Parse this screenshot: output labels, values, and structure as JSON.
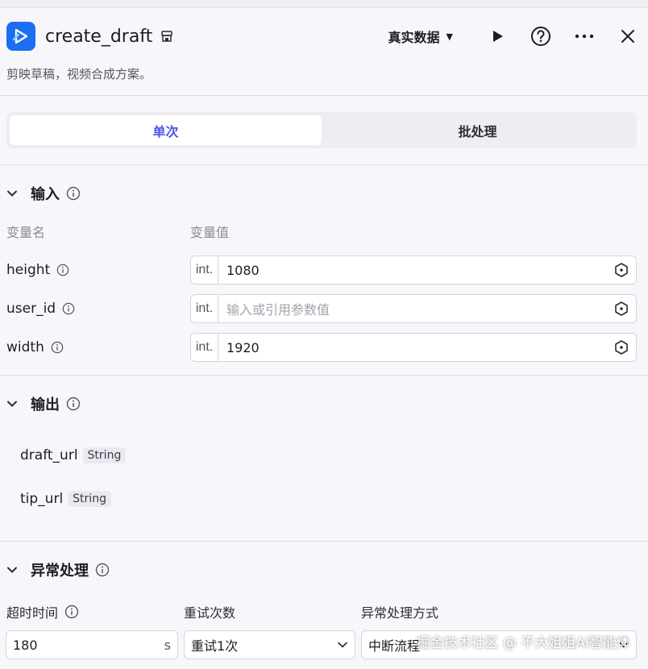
{
  "header": {
    "title": "create_draft",
    "mode_label": "真实数据",
    "description": "剪映草稿，视频合成方案。"
  },
  "tabs": [
    {
      "label": "单次",
      "active": true
    },
    {
      "label": "批处理",
      "active": false
    }
  ],
  "input": {
    "title": "输入",
    "col_name": "变量名",
    "col_value": "变量值",
    "vars": [
      {
        "name": "height",
        "type": "int.",
        "value": "1080"
      },
      {
        "name": "user_id",
        "type": "int.",
        "placeholder": "输入或引用参数值"
      },
      {
        "name": "width",
        "type": "int.",
        "value": "1920"
      }
    ]
  },
  "output": {
    "title": "输出",
    "vars": [
      {
        "name": "draft_url",
        "type": "String"
      },
      {
        "name": "tip_url",
        "type": "String"
      }
    ]
  },
  "error": {
    "title": "异常处理",
    "timeout_label": "超时时间",
    "retry_label": "重试次数",
    "method_label": "异常处理方式",
    "timeout_value": "180",
    "timeout_unit": "s",
    "retry_value": "重试1次",
    "method_value": "中断流程"
  },
  "watermark": "掘金技术社区 @ 不大姐姐AI智能体",
  "colors": {
    "accent": "#4d53e8",
    "app_icon": "#1c6ef2"
  }
}
